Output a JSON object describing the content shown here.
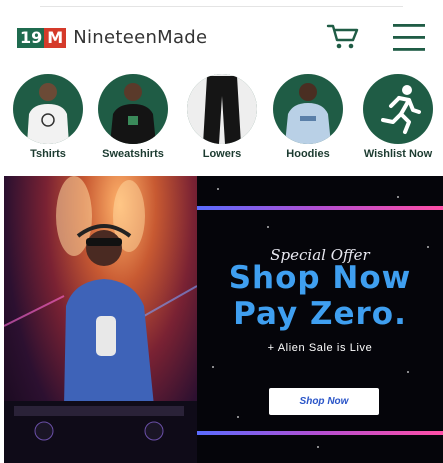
{
  "brand": {
    "mark_left": "19",
    "mark_right": "M",
    "name": "NineteenMade"
  },
  "header": {
    "cart_icon": "cart-icon",
    "menu_icon": "hamburger-menu-icon"
  },
  "categories": [
    {
      "label": "Tshirts"
    },
    {
      "label": "Sweatshirts"
    },
    {
      "label": "Lowers"
    },
    {
      "label": "Hoodies"
    },
    {
      "label": "Wishlist Now"
    }
  ],
  "hero": {
    "special_offer": "Special Offer",
    "headline_1": "Shop Now",
    "headline_2": "Pay Zero.",
    "subtext": "+ Alien Sale is Live",
    "cta_label": "Shop Now"
  },
  "colors": {
    "brand_green": "#1f5c45",
    "brand_red": "#d53a2a",
    "promo_blue": "#3f9ff0"
  }
}
